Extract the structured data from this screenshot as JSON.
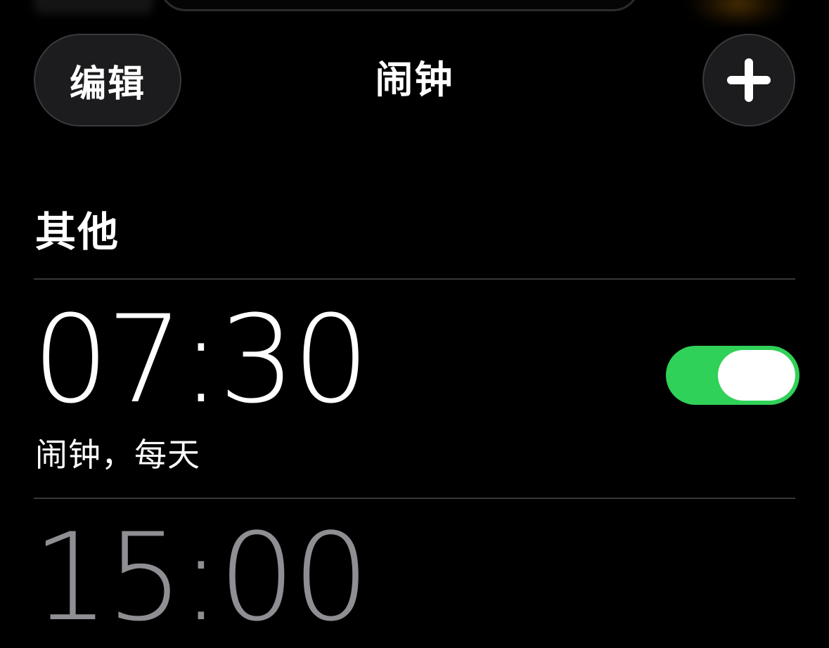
{
  "nav": {
    "edit_label": "编辑",
    "title": "闹钟",
    "add_label": "+"
  },
  "section": {
    "title": "其他"
  },
  "alarms": [
    {
      "time": "07:30",
      "label": "闹钟，每天",
      "enabled": true
    },
    {
      "time": "15:00"
    }
  ],
  "colors": {
    "background": "#000000",
    "toggle_on": "#30d158",
    "button_bg": "#1c1c1e",
    "divider": "#38383a",
    "accent_ghost": "#ff9f0a"
  }
}
